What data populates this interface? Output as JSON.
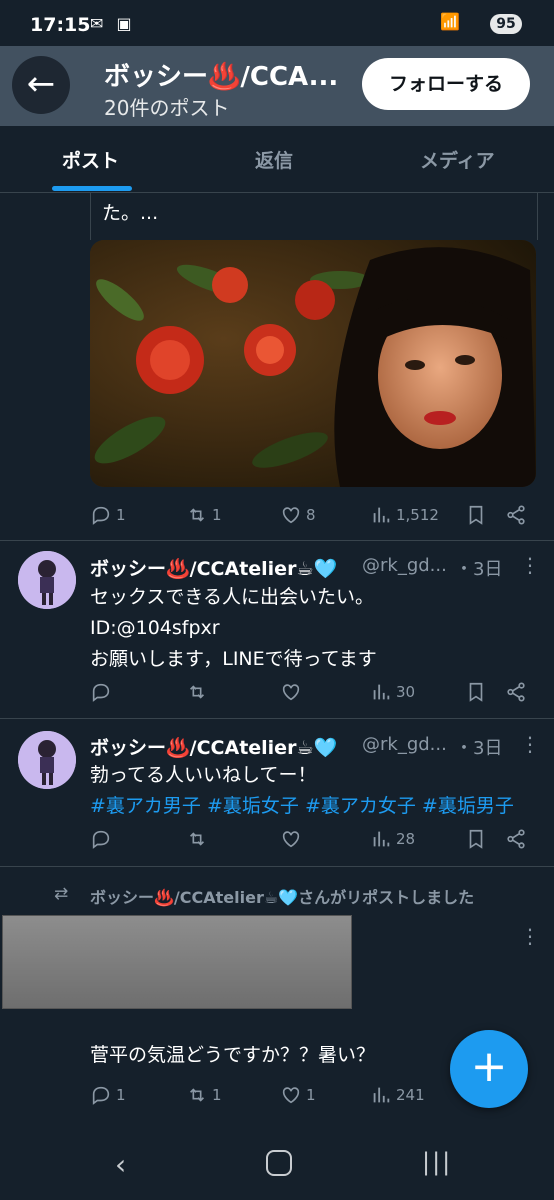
{
  "status_bar": {
    "time": "17:15",
    "battery": "95"
  },
  "header": {
    "back_label": "←",
    "title": "ボッシー♨️/CCA...",
    "subtitle": "20件のポスト",
    "follow_label": "フォローする"
  },
  "tabs": [
    {
      "label": "ポスト"
    },
    {
      "label": "返信"
    },
    {
      "label": "メディア"
    }
  ],
  "post1": {
    "text_tail": "た。...",
    "replies": "1",
    "reposts": "1",
    "likes": "8",
    "views": "1,512"
  },
  "post2": {
    "name": "ボッシー♨️/CCAtelier☕🩵",
    "handle": "@rk_gd...",
    "time": "・3日",
    "lines": [
      "セックスできる人に出会いたい。",
      "ID:@104sfpxr",
      "お願いします，LINEで待ってます"
    ],
    "views": "30"
  },
  "post3": {
    "name": "ボッシー♨️/CCAtelier☕🩵",
    "handle": "@rk_gd...",
    "time": "・3日",
    "line1": "勃ってる人いいねしてー！",
    "hashtags": [
      "#裏アカ男子",
      "#裏垢女子",
      "#裏アカ女子",
      "#裏垢男子"
    ],
    "views": "28"
  },
  "post4": {
    "repost_notice": "ボッシー♨️/CCAtelier☕🩵さんがリポストしました",
    "text": "菅平の気温どうですか？？暑い？",
    "replies": "1",
    "reposts": "1",
    "likes": "1",
    "views": "241"
  },
  "colors": {
    "accent": "#1d9bf0",
    "background": "#15202b",
    "header_bg": "#425160"
  },
  "fab_label": "+"
}
